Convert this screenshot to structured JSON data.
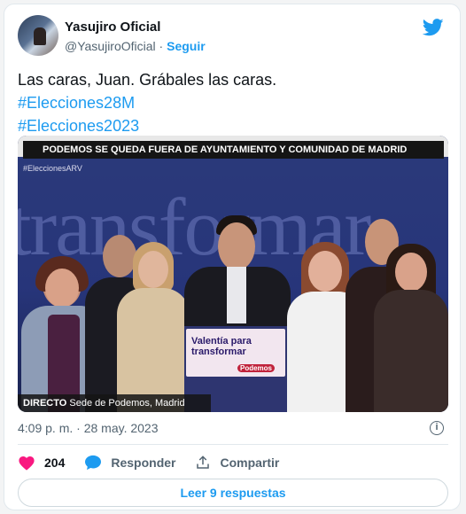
{
  "tweet": {
    "author_name": "Yasujiro Oficial",
    "handle": "@YasujiroOficial",
    "separator": "·",
    "follow_label": "Seguir",
    "text_line1": "Las caras, Juan. Grábales las caras.",
    "hashtag1": "#Elecciones28M",
    "hashtag2": "#Elecciones2023",
    "timestamp": "4:09 p. m. · 28 may. 2023",
    "likes_count": "204",
    "reply_label": "Responder",
    "share_label": "Compartir",
    "read_replies_label": "Leer 9 respuestas"
  },
  "media": {
    "banner_text": "PODEMOS SE QUEDA FUERA DE AYUNTAMIENTO Y COMUNIDAD DE MADRID",
    "overlay_hashtag": "#EleccionesARV",
    "background_word": "transformar",
    "podium_sign": "Valentía para transformar",
    "podium_logo": "Podemos",
    "live_label": "DIRECTO",
    "live_location": "Sede de Podemos, Madrid"
  },
  "colors": {
    "accent": "#1d9bf0",
    "like": "#f91880"
  },
  "icons": {
    "platform": "twitter-bird-icon",
    "like": "heart-icon",
    "reply": "speech-bubble-icon",
    "share": "share-icon",
    "info": "info-icon"
  }
}
